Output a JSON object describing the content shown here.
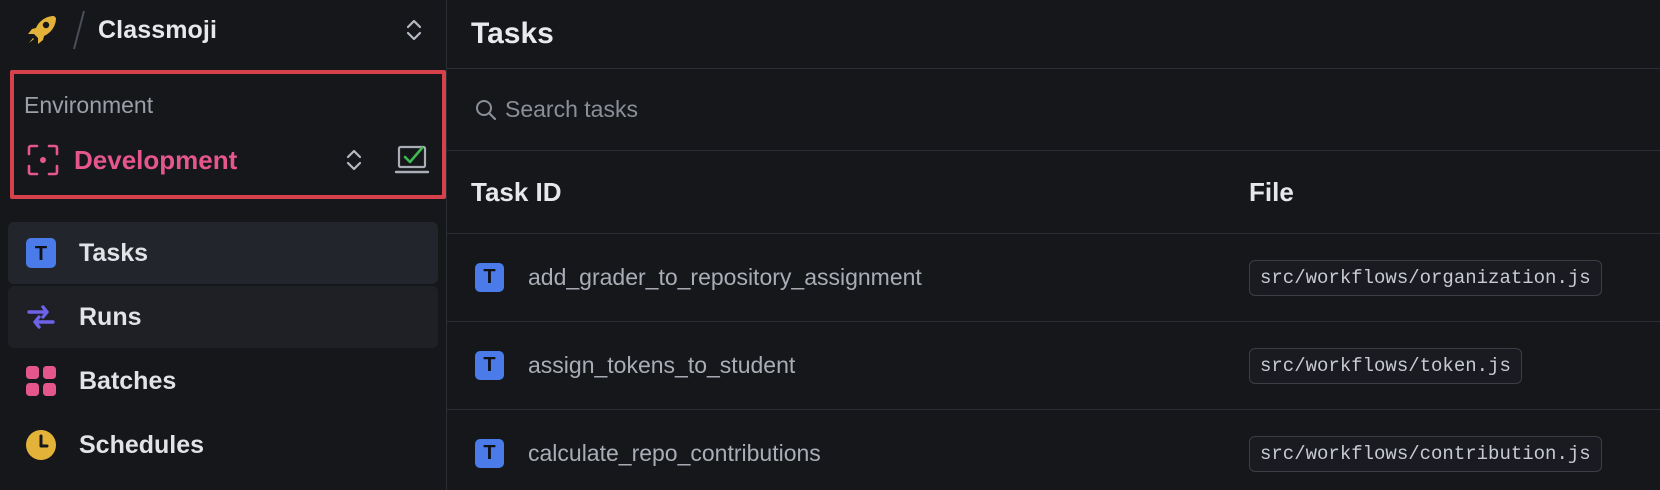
{
  "org": {
    "name": "Classmoji"
  },
  "environment": {
    "label": "Environment",
    "name": "Development"
  },
  "nav": {
    "items": [
      {
        "label": "Tasks",
        "icon": "task-icon",
        "color": "#4a7be8"
      },
      {
        "label": "Runs",
        "icon": "runs-icon",
        "color": "#6c63e8"
      },
      {
        "label": "Batches",
        "icon": "batches-icon",
        "color": "#e5568d"
      },
      {
        "label": "Schedules",
        "icon": "clock-icon",
        "color": "#e3b339"
      }
    ]
  },
  "page": {
    "title": "Tasks"
  },
  "search": {
    "placeholder": "Search tasks"
  },
  "table": {
    "headers": {
      "task_id": "Task ID",
      "file": "File"
    },
    "rows": [
      {
        "task_id": "add_grader_to_repository_assignment",
        "file": "src/workflows/organization.js"
      },
      {
        "task_id": "assign_tokens_to_student",
        "file": "src/workflows/token.js"
      },
      {
        "task_id": "calculate_repo_contributions",
        "file": "src/workflows/contribution.js"
      }
    ]
  },
  "colors": {
    "accent_env": "#e5568d",
    "highlight_border": "#d6414b",
    "task_badge": "#4a7be8"
  }
}
